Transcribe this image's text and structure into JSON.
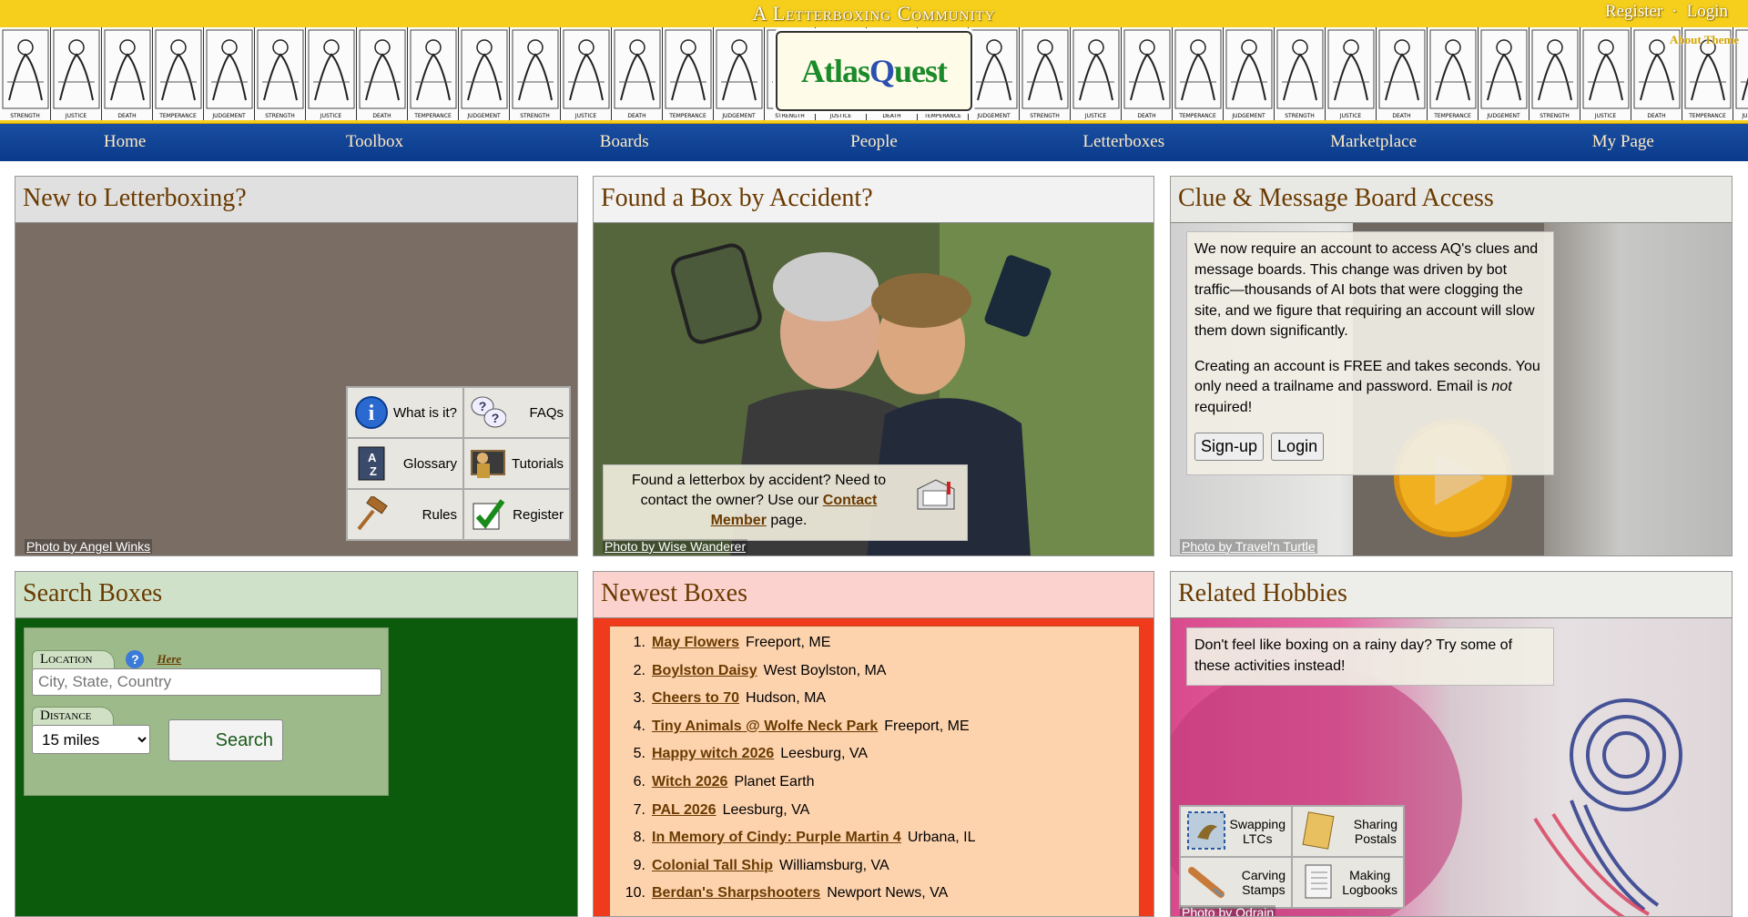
{
  "header": {
    "tagline": "A Letterboxing Community",
    "register": "Register",
    "separator": "·",
    "login": "Login",
    "about_theme": "About Theme",
    "logo": {
      "pre": "Atlas",
      "q": "Q",
      "post": "uest"
    },
    "cards": [
      "STRENGTH",
      "JUSTICE",
      "DEATH",
      "TEMPERANCE",
      "JUDGEMENT"
    ]
  },
  "nav": [
    "Home",
    "Toolbox",
    "Boards",
    "People",
    "Letterboxes",
    "Marketplace",
    "My Page"
  ],
  "new_to": {
    "title": "New to Letterboxing?",
    "buttons": [
      {
        "label": "What is it?",
        "icon": "info-icon"
      },
      {
        "label": "FAQs",
        "icon": "question-bubbles-icon"
      },
      {
        "label": "Glossary",
        "icon": "a-z-book-icon"
      },
      {
        "label": "Tutorials",
        "icon": "teacher-icon"
      },
      {
        "label": "Rules",
        "icon": "gavel-icon"
      },
      {
        "label": "Register",
        "icon": "checkmark-icon"
      }
    ],
    "credit": "Photo by Angel Winks"
  },
  "found": {
    "title": "Found a Box by Accident?",
    "text_before": "Found a letterbox by accident? Need to contact the owner? Use our",
    "link": "Contact Member",
    "text_after": "page.",
    "credit": "Photo by Wise Wanderer"
  },
  "clue": {
    "title": "Clue & Message Board Access",
    "para1": "We now require an account to access AQ's clues and message boards. This change was driven by bot traffic—thousands of AI bots that were clogging the site, and we figure that requiring an account will slow them down significantly.",
    "para2_a": "Creating an account is FREE and takes seconds. You only need a trailname and password. Email is",
    "para2_em": "not",
    "para2_b": "required!",
    "signup": "Sign-up",
    "login": "Login",
    "credit": "Photo by Travel'n Turtle"
  },
  "search": {
    "title": "Search Boxes",
    "location_label": "Location",
    "help": "?",
    "here": "Here",
    "location_placeholder": "City, State, Country",
    "distance_label": "Distance",
    "distance_value": "15 miles",
    "button": "Search"
  },
  "newest": {
    "title": "Newest Boxes",
    "items": [
      {
        "n": "1.",
        "name": "May Flowers",
        "loc": "Freeport, ME"
      },
      {
        "n": "2.",
        "name": "Boylston Daisy",
        "loc": "West Boylston, MA"
      },
      {
        "n": "3.",
        "name": "Cheers to 70",
        "loc": "Hudson, MA"
      },
      {
        "n": "4.",
        "name": "Tiny Animals @ Wolfe Neck Park",
        "loc": "Freeport, ME"
      },
      {
        "n": "5.",
        "name": "Happy witch 2026",
        "loc": "Leesburg, VA"
      },
      {
        "n": "6.",
        "name": "Witch 2026",
        "loc": "Planet Earth"
      },
      {
        "n": "7.",
        "name": "PAL 2026",
        "loc": "Leesburg, VA"
      },
      {
        "n": "8.",
        "name": "In Memory of Cindy: Purple Martin 4",
        "loc": "Urbana, IL"
      },
      {
        "n": "9.",
        "name": "Colonial Tall Ship",
        "loc": "Williamsburg, VA"
      },
      {
        "n": "10.",
        "name": "Berdan's Sharpshooters",
        "loc": "Newport News, VA"
      }
    ]
  },
  "hobbies": {
    "title": "Related Hobbies",
    "text": "Don't feel like boxing on a rainy day? Try some of these activities instead!",
    "buttons": [
      {
        "l1": "Swapping",
        "l2": "LTCs",
        "icon": "bird-stamp-icon"
      },
      {
        "l1": "Sharing",
        "l2": "Postals",
        "icon": "postcard-icon"
      },
      {
        "l1": "Carving",
        "l2": "Stamps",
        "icon": "carving-tool-icon"
      },
      {
        "l1": "Making",
        "l2": "Logbooks",
        "icon": "notebook-icon"
      }
    ],
    "credit": "Photo by Odrain"
  }
}
